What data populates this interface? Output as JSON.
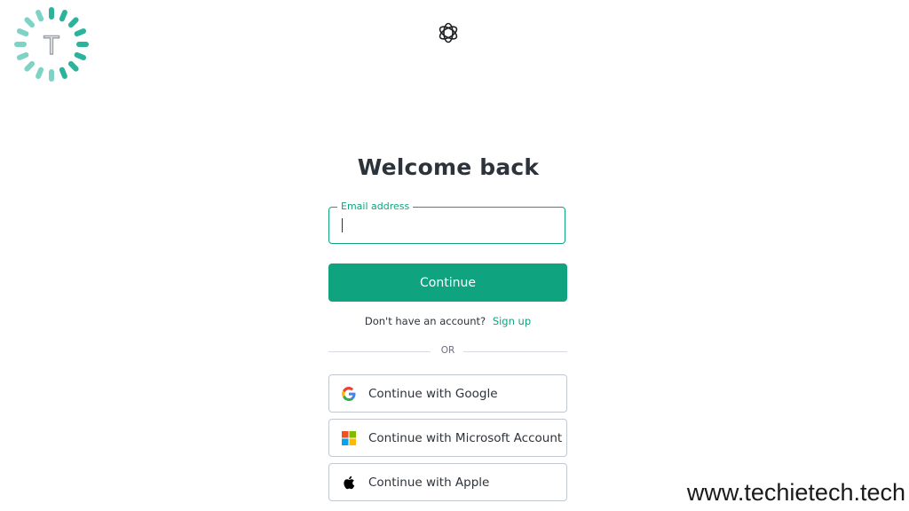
{
  "watermark": {
    "logo_icon": "techietech-logo-icon",
    "site": "www.techietech.tech"
  },
  "brand": {
    "icon": "openai-logo-icon"
  },
  "login": {
    "title": "Welcome back",
    "email_label": "Email address",
    "email_value": "",
    "continue_label": "Continue",
    "no_account_text": "Don't have an account?",
    "signup_label": "Sign up",
    "divider_text": "OR",
    "google_label": "Continue with Google",
    "microsoft_label": "Continue with Microsoft Account",
    "apple_label": "Continue with Apple"
  },
  "colors": {
    "accent": "#10a37f",
    "text": "#2d333a",
    "border": "#c2c8d0"
  }
}
